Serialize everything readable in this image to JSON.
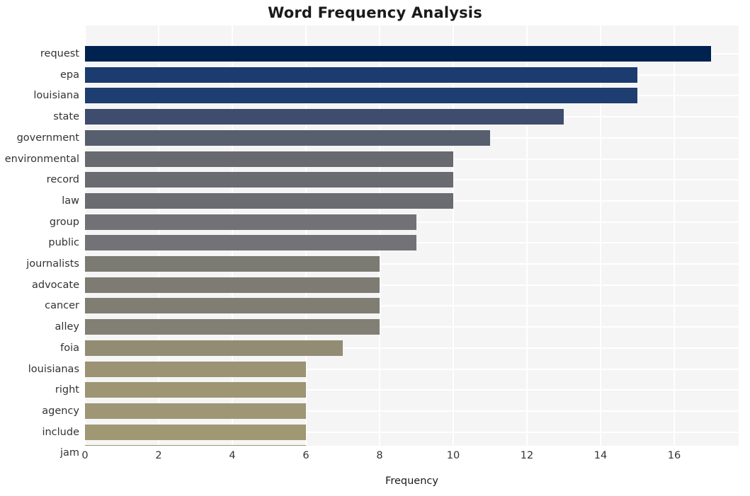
{
  "chart_data": {
    "type": "bar",
    "orientation": "horizontal",
    "title": "Word Frequency Analysis",
    "xlabel": "Frequency",
    "ylabel": "",
    "categories": [
      "request",
      "epa",
      "louisiana",
      "state",
      "government",
      "environmental",
      "record",
      "law",
      "group",
      "public",
      "journalists",
      "advocate",
      "cancer",
      "alley",
      "foia",
      "louisianas",
      "right",
      "agency",
      "include",
      "jam"
    ],
    "values": [
      17,
      15,
      15,
      13,
      11,
      10,
      10,
      10,
      9,
      9,
      8,
      8,
      8,
      8,
      7,
      6,
      6,
      6,
      6,
      6
    ],
    "bar_colors": [
      "#00224e",
      "#1c3b६e",
      "#1e3d70",
      "#3e4c6d",
      "#575e6d",
      "#686a70",
      "#6a6b70",
      "#6b6c71",
      "#727175",
      "#737276",
      "#7b7a73",
      "#7d7b73",
      "#807d73",
      "#827f74",
      "#928c74",
      "#9b9374",
      "#9d9574",
      "#9e9674",
      "#a09773",
      "#a09573"
    ],
    "xlim": [
      0,
      17.75
    ],
    "xticks": [
      0,
      2,
      4,
      6,
      8,
      10,
      12,
      14,
      16
    ],
    "xtick_labels": [
      "0",
      "2",
      "4",
      "6",
      "8",
      "10",
      "12",
      "14",
      "16"
    ],
    "grid": true,
    "grid_color": "#ffffff",
    "plot_background": "#f5f5f6",
    "figure_background": "#ffffff",
    "legend": null,
    "colormap": "cividis"
  }
}
